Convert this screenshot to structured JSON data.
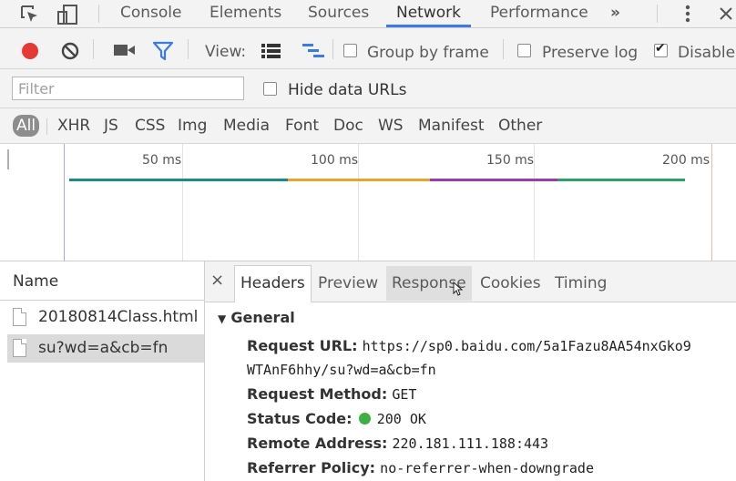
{
  "tabs": [
    "Console",
    "Elements",
    "Sources",
    "Network",
    "Performance"
  ],
  "more_tabs_glyph": "»",
  "toolbar": {
    "view_label": "View:",
    "group_by_frame": "Group by frame",
    "preserve_log": "Preserve log",
    "disable_cache": "Disable",
    "record_color": "#e53935",
    "filter_icon_color": "#3b7be8"
  },
  "filter": {
    "placeholder": "Filter",
    "hide_data_urls": "Hide data URLs"
  },
  "types": [
    "All",
    "XHR",
    "JS",
    "CSS",
    "Img",
    "Media",
    "Font",
    "Doc",
    "WS",
    "Manifest",
    "Other"
  ],
  "timeline": {
    "ticks": [
      "50 ms",
      "100 ms",
      "150 ms",
      "200 ms"
    ],
    "colors": [
      "#1a8a8a",
      "#e8a52a",
      "#9c3bb0",
      "#2aa06a",
      "#1a8a8a"
    ]
  },
  "requests": {
    "header": "Name",
    "items": [
      "20180814Class.html",
      "su?wd=a&cb=fn"
    ]
  },
  "detail": {
    "close": "×",
    "tabs": [
      "Headers",
      "Preview",
      "Response",
      "Cookies",
      "Timing"
    ],
    "section": "General",
    "request_url_label": "Request URL:",
    "request_url_value": "https://sp0.baidu.com/5a1Fazu8AA54nxGko9",
    "request_url_value_2": "WTAnF6hhy/su?wd=a&cb=fn",
    "request_method_label": "Request Method:",
    "request_method_value": "GET",
    "status_code_label": "Status Code:",
    "status_code_value": "200 OK",
    "status_color": "#3cb043",
    "remote_address_label": "Remote Address:",
    "remote_address_value": "220.181.111.188:443",
    "referrer_policy_label": "Referrer Policy:",
    "referrer_policy_value": "no-referrer-when-downgrade"
  }
}
